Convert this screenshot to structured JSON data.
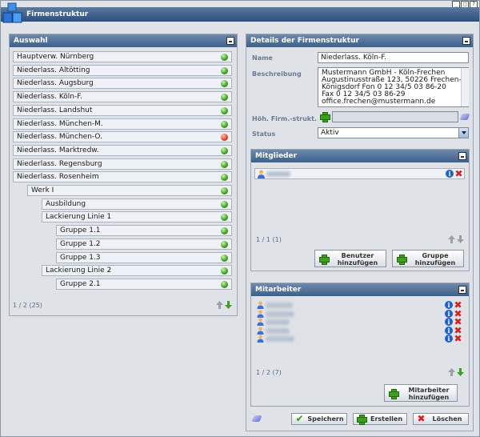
{
  "window": {
    "title": "Firmenstruktur",
    "controls": [
      "_",
      "□",
      "?"
    ]
  },
  "left_panel": {
    "title": "Auswahl",
    "items": [
      {
        "label": "Hauptverw. Nürnberg",
        "indent": 0,
        "status": "green"
      },
      {
        "label": "Niederlass. Altötting",
        "indent": 0,
        "status": "green"
      },
      {
        "label": "Niederlass. Augsburg",
        "indent": 0,
        "status": "green"
      },
      {
        "label": "Niederlass. Köln-F.",
        "indent": 0,
        "status": "green"
      },
      {
        "label": "Niederlass. Landshut",
        "indent": 0,
        "status": "green"
      },
      {
        "label": "Niederlass. München-M.",
        "indent": 0,
        "status": "green"
      },
      {
        "label": "Niederlass. München-O.",
        "indent": 0,
        "status": "red"
      },
      {
        "label": "Niederlass. Marktredw.",
        "indent": 0,
        "status": "green"
      },
      {
        "label": "Niederlass. Regensburg",
        "indent": 0,
        "status": "green"
      },
      {
        "label": "Niederlass. Rosenheim",
        "indent": 0,
        "status": "green"
      },
      {
        "label": "Werk I",
        "indent": 1,
        "status": "green"
      },
      {
        "label": "Ausbildung",
        "indent": 2,
        "status": "green"
      },
      {
        "label": "Lackierung Linie 1",
        "indent": 2,
        "status": "green"
      },
      {
        "label": "Gruppe 1.1",
        "indent": 3,
        "status": "green"
      },
      {
        "label": "Gruppe 1.2",
        "indent": 3,
        "status": "green"
      },
      {
        "label": "Gruppe 1.3",
        "indent": 3,
        "status": "green"
      },
      {
        "label": "Lackierung Linie 2",
        "indent": 2,
        "status": "green"
      },
      {
        "label": "Gruppe 2.1",
        "indent": 3,
        "status": "green"
      }
    ],
    "pager": "1 / 2 (25)"
  },
  "details": {
    "title": "Details der Firmenstruktur",
    "name_label": "Name",
    "name_value": "Niederlass. Köln-F.",
    "desc_label": "Beschreibung",
    "desc_value": "Mustermann GmbH - Köln-Frechen\nAugustinusstraße 123, 50226 Frechen-\nKönigsdorf Fon 0 12 34/5 03 86-20\nFax 0 12 34/5 03 86-29\noffice.frechen@mustermann.de",
    "parent_label": "Höh. Firm.-strukt.",
    "status_label": "Status",
    "status_value": "Aktiv"
  },
  "members": {
    "title": "Mitglieder",
    "pager": "1 / 1 (1)",
    "add_user": "Benutzer\nhinzufügen",
    "add_group": "Gruppe\nhinzufügen"
  },
  "employees": {
    "title": "Mitarbeiter",
    "pager": "1 / 2 (7)",
    "add_employee": "Mitarbeiter\nhinzufügen"
  },
  "footer": {
    "save": "Speichern",
    "create": "Erstellen",
    "delete": "Löschen"
  },
  "colors": {
    "header": "#3d5f88",
    "status_green": "#3ea01e",
    "status_red": "#e0401e",
    "bg": "#dfe3e8"
  }
}
